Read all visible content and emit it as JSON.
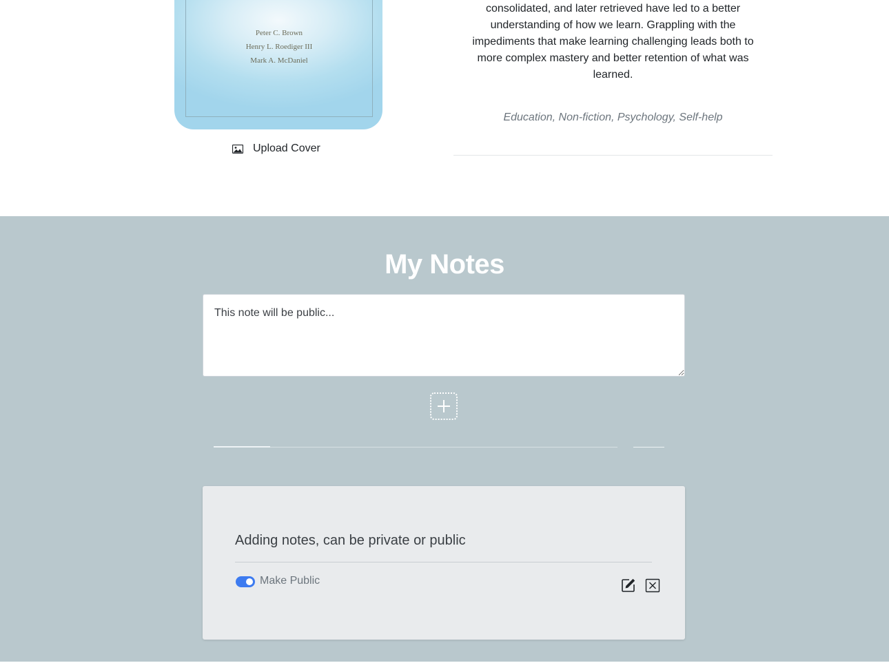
{
  "book": {
    "authors": [
      "Peter C. Brown",
      "Henry L. Roediger III",
      "Mark A. McDaniel"
    ],
    "upload_cover_label": "Upload Cover",
    "description_lines": [
      "consolidated, and later retrieved have led to a better",
      "understanding of how we learn. Grappling with the",
      "impediments that make learning challenging leads both to",
      "more complex mastery and better retention of what was",
      "learned."
    ],
    "genres": "Education, Non-fiction, Psychology, Self-help"
  },
  "notes": {
    "title": "My Notes",
    "input_placeholder": "This note will be public...",
    "items": [
      {
        "text": "Adding notes, can be private or public",
        "toggle_label": "Make Public",
        "is_public": true
      }
    ]
  },
  "icons": {
    "upload": "image-icon",
    "add": "plus-icon",
    "edit": "edit-icon",
    "delete": "close-icon"
  },
  "colors": {
    "notes_bg": "#b9c8cd",
    "toggle_on": "#3d7bf0",
    "cover_blue": "#a2d5ec"
  }
}
